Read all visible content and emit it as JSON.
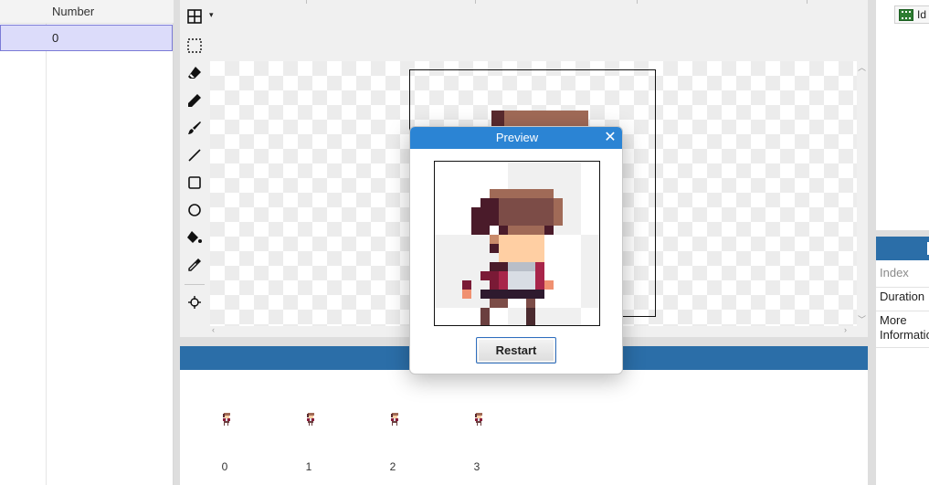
{
  "left_table": {
    "column_header": "Number",
    "selected_row_value": "0"
  },
  "toolbar": {
    "tools": [
      "grid-icon",
      "select-rect-icon",
      "eraser-icon",
      "pencil-icon",
      "brush-icon",
      "line-icon",
      "rectangle-icon",
      "ellipse-icon",
      "fill-bucket-icon",
      "eyedropper-icon",
      "crosshair-icon"
    ],
    "grid_dropdown_caret": "▾"
  },
  "preview_dialog": {
    "title": "Preview",
    "close_glyph": "✕",
    "restart_label": "Restart"
  },
  "frames": [
    {
      "label": "0"
    },
    {
      "label": "1"
    },
    {
      "label": "2"
    },
    {
      "label": "3"
    }
  ],
  "animation_list": {
    "item_label": "Id"
  },
  "properties": {
    "rows": [
      {
        "label": "Index"
      },
      {
        "label": "Duration"
      },
      {
        "label": "More Information"
      }
    ]
  },
  "colors": {
    "accent_blue": "#2b6ea8",
    "dialog_title_blue": "#2b84d4",
    "selection_bg": "#dcdcfa",
    "hair_light": "#a06a57",
    "hair_dark": "#5a2a2e",
    "skin": "#ffcfa3",
    "shirt_red": "#8a1f3c",
    "shirt_white": "#d8dde4",
    "pants": "#6b3f3f"
  }
}
